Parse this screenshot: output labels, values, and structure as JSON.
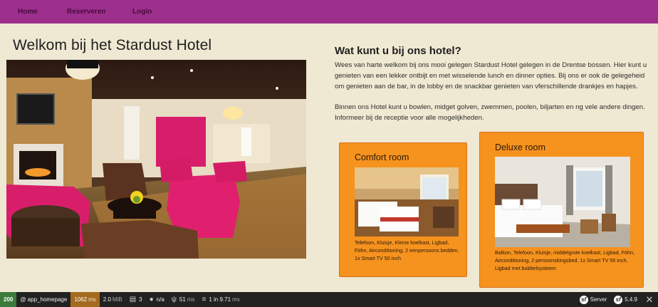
{
  "nav": {
    "items": [
      {
        "label": "Home"
      },
      {
        "label": "Reserveren"
      },
      {
        "label": "Login"
      }
    ]
  },
  "main": {
    "title": "Welkom bij het Stardust Hotel"
  },
  "about": {
    "heading": "Wat kunt u bij ons hotel?",
    "paragraph1": "Wees van harte welkom bij ons mooi gelegen Stardust Hotel gelegen in de Drentse bossen. Hier kunt u genieten van een lekker ontbijt en met wisselende lunch en dinner opties. Bij ons er ook de gelegeheid om genieten aan de bar, in de lobby en de snackbar genieten van vferschillende drankjes en hapjes.",
    "paragraph2": "Binnen ons Hotel kunt u bowlen, midget golven, zwemmen, poolen, biljarten en ng vele andere dingen. Informeer bij de receptie voor alle mogelijkheden."
  },
  "rooms": [
    {
      "name": "Comfort room",
      "amenities": "Telefoon, Kluisje, Kleine koelkast, Ligbad, Föhn, Airconditioning, 2 eenpersoons bedden, 1x Smart TV 50 inch"
    },
    {
      "name": "Deluxe room",
      "amenities": "Balkon, Telefoon, Kluisje, middelgrote koelkast, Ligbad, Föhn, Airconditioning, 2 persoonskingsbed, 1x Smart TV 55 inch, Ligbad met bubbelsysteem"
    }
  ],
  "debug_toolbar": {
    "status": "200",
    "route": "@ app_homepage",
    "time": "1062",
    "time_unit": "ms",
    "memory": "2.0",
    "memory_unit": "MiB",
    "forms": "3",
    "user": "n/a",
    "twig_time": "51",
    "twig_unit": "ms",
    "db": "1 in 9.71",
    "db_unit": "ms",
    "server": "Server",
    "version": "5.4.9"
  }
}
